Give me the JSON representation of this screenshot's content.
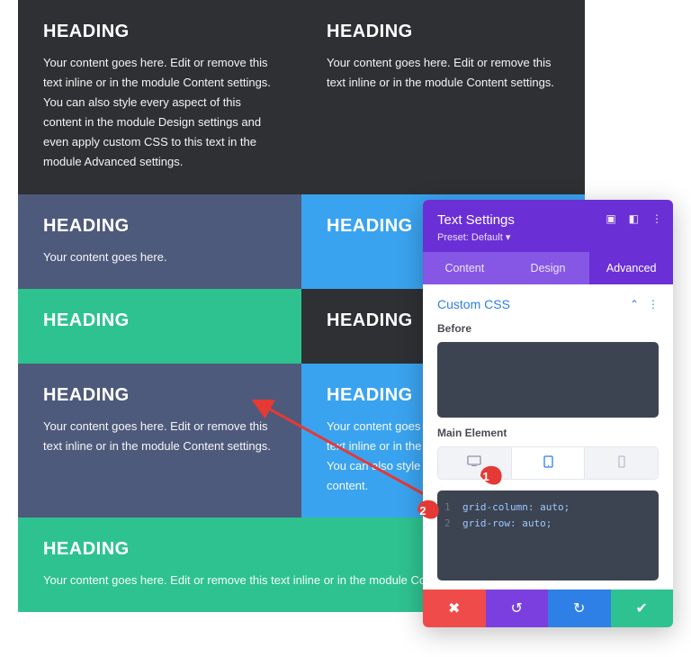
{
  "grid": {
    "row1": [
      {
        "heading": "HEADING",
        "body": "Your content goes here. Edit or remove this text inline or in the module Content settings. You can also style every aspect of this content in the module Design settings and even apply custom CSS to this text in the module Advanced settings."
      },
      {
        "heading": "HEADING",
        "body": "Your content goes here. Edit or remove this text inline or in the module Content settings."
      }
    ],
    "row2": [
      {
        "heading": "HEADING",
        "body": "Your content goes here."
      },
      {
        "heading": "HEADING",
        "body": ""
      }
    ],
    "row3": [
      {
        "heading": "HEADING",
        "body": ""
      },
      {
        "heading": "HEADING",
        "body": ""
      }
    ],
    "row4": [
      {
        "heading": "HEADING",
        "body": "Your content goes here. Edit or remove this text inline or in the module Content settings."
      },
      {
        "heading": "HEADING",
        "body": "Your content goes here. Edit or remove this text inline or in the module Content settings. You can also style every aspect of this content."
      }
    ],
    "row5": [
      {
        "heading": "HEADING",
        "body": "Your content goes here. Edit or remove this text inline or in the module Content settings."
      }
    ]
  },
  "panel": {
    "title": "Text Settings",
    "preset": "Preset: Default ▾",
    "tabs": {
      "content": "Content",
      "design": "Design",
      "advanced": "Advanced"
    },
    "section_title": "Custom CSS",
    "before_label": "Before",
    "main_label": "Main Element",
    "code_line1": "grid-column: auto;",
    "code_line2": "grid-row: auto;"
  },
  "annotations": {
    "marker1": "1",
    "marker2": "2"
  }
}
